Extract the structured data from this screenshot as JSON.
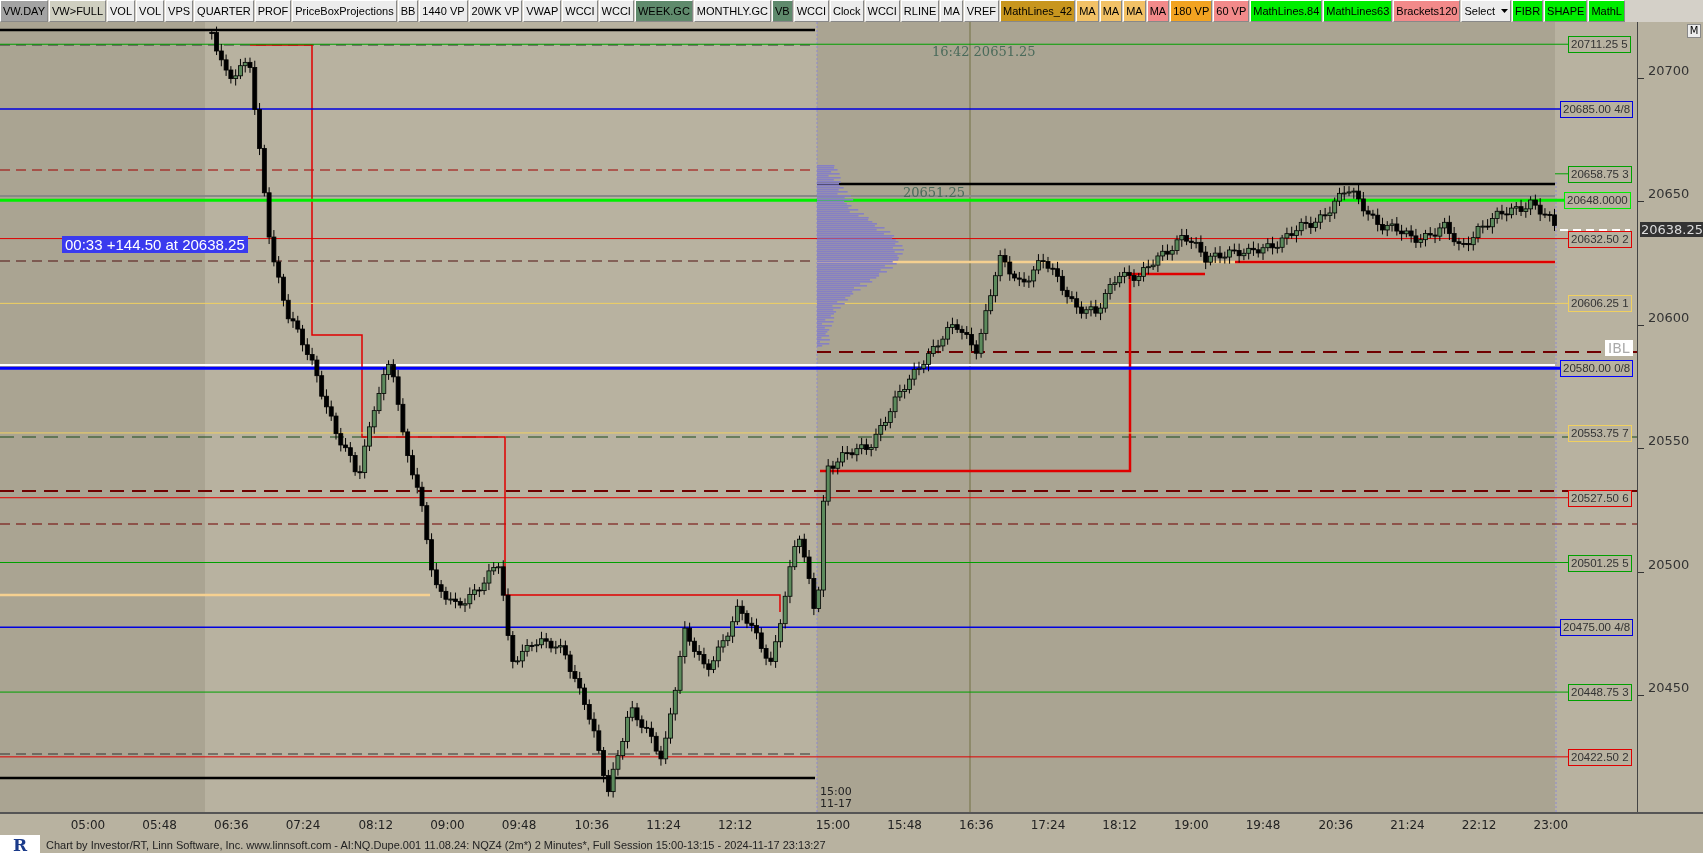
{
  "toolbar": {
    "buttons": [
      {
        "label": "VW.DAY",
        "color": "#a3a3a3"
      },
      {
        "label": "VW>FULL",
        "color": "#cfcfc0"
      },
      {
        "label": "VOL",
        "color": "#ececec"
      },
      {
        "label": "VOL",
        "color": "#ececec"
      },
      {
        "label": "VPS",
        "color": "#ececec"
      },
      {
        "label": "QUARTER",
        "color": "#ececec"
      },
      {
        "label": "PROF",
        "color": "#ececec"
      },
      {
        "label": "PriceBoxProjections",
        "color": "#ececec"
      },
      {
        "label": "BB",
        "color": "#ececec"
      },
      {
        "label": "1440 VP",
        "color": "#ececec"
      },
      {
        "label": "20WK VP",
        "color": "#ececec"
      },
      {
        "label": "VWAP",
        "color": "#ececec"
      },
      {
        "label": "WCCI",
        "color": "#ececec"
      },
      {
        "label": "WCCI",
        "color": "#ececec"
      },
      {
        "label": "WEEK.GC",
        "color": "#5f8a6c"
      },
      {
        "label": "MONTHLY.GC",
        "color": "#ececec"
      },
      {
        "label": "VB",
        "color": "#5f8a6c"
      },
      {
        "label": "WCCI",
        "color": "#ececec"
      },
      {
        "label": "Clock",
        "color": "#ececec"
      },
      {
        "label": "WCCI",
        "color": "#ececec"
      },
      {
        "label": "RLINE",
        "color": "#ececec"
      },
      {
        "label": "MA",
        "color": "#ececec"
      },
      {
        "label": "VREF",
        "color": "#ececec"
      },
      {
        "label": "MathLines_42",
        "color": "#c8961e"
      },
      {
        "label": "MA",
        "color": "#f2c166"
      },
      {
        "label": "MA",
        "color": "#f2c166"
      },
      {
        "label": "MA",
        "color": "#f2c166"
      },
      {
        "label": "MA",
        "color": "#f28a8a"
      },
      {
        "label": "180 VP",
        "color": "#f2a321"
      },
      {
        "label": "60 VP",
        "color": "#f28a8a"
      },
      {
        "label": "MathLines.84",
        "color": "#00ee00"
      },
      {
        "label": "MathLines63",
        "color": "#00ee00"
      },
      {
        "label": "Brackets120",
        "color": "#f28a8a"
      },
      {
        "label": "Select",
        "color": "#ececec",
        "kind": "dropdown"
      },
      {
        "label": "FIBR",
        "color": "#00ee00"
      },
      {
        "label": "SHAPE",
        "color": "#00ee00"
      },
      {
        "label": "MathL",
        "color": "#00ee00"
      }
    ]
  },
  "chart": {
    "time_price_label": "16:42  20651.25",
    "profile_label": "20651.25",
    "tracker_label": "00:33  +144.50 at 20638.25",
    "ib_label": "IBL",
    "session_time": "15:00",
    "session_date": "11-17",
    "level_lines": [
      {
        "label": "20711.25 5",
        "color": "#00a000"
      },
      {
        "label": "20685.00 4/8",
        "color": "#0000e0"
      },
      {
        "label": "20658.75 3",
        "color": "#00a000"
      },
      {
        "label": "20648.0000",
        "color": "#00ee00"
      },
      {
        "label": "20632.50 2",
        "color": "#e00000"
      },
      {
        "label": "20606.25 1",
        "color": "#f0d060"
      },
      {
        "label": "20580.00 0/8",
        "color": "#0000ff"
      },
      {
        "label": "20553.75 7",
        "color": "#f0d060"
      },
      {
        "label": "20527.50 6",
        "color": "#e00000"
      },
      {
        "label": "20501.25 5",
        "color": "#00a000"
      },
      {
        "label": "20475.00 4/8",
        "color": "#0000e0"
      },
      {
        "label": "20448.75 3",
        "color": "#00a000"
      },
      {
        "label": "20422.50 2",
        "color": "#e00000"
      }
    ]
  },
  "price_axis": {
    "corner_button": "M",
    "ticks": [
      "20700",
      "20650",
      "20600",
      "20550",
      "20500",
      "20450"
    ],
    "current_price": "20638.25"
  },
  "time_axis": {
    "ticks": [
      "05:00",
      "05:48",
      "06:36",
      "07:24",
      "08:12",
      "09:00",
      "09:48",
      "10:36",
      "11:24",
      "12:12",
      "15:00",
      "15:48",
      "16:36",
      "17:24",
      "18:12",
      "19:00",
      "19:48",
      "20:36",
      "21:24",
      "22:12",
      "23:00"
    ]
  },
  "status_bar": {
    "logo": "R",
    "text": "Chart by Investor/RT, Linn Software, Inc. www.linnsoft.com - AI:NQ.Dupe.001   11.08.24: NQZ4 (2m*) 2 Minutes*, Full Session 15:00-13:15 - 2024-11-17 23:13:27"
  }
}
